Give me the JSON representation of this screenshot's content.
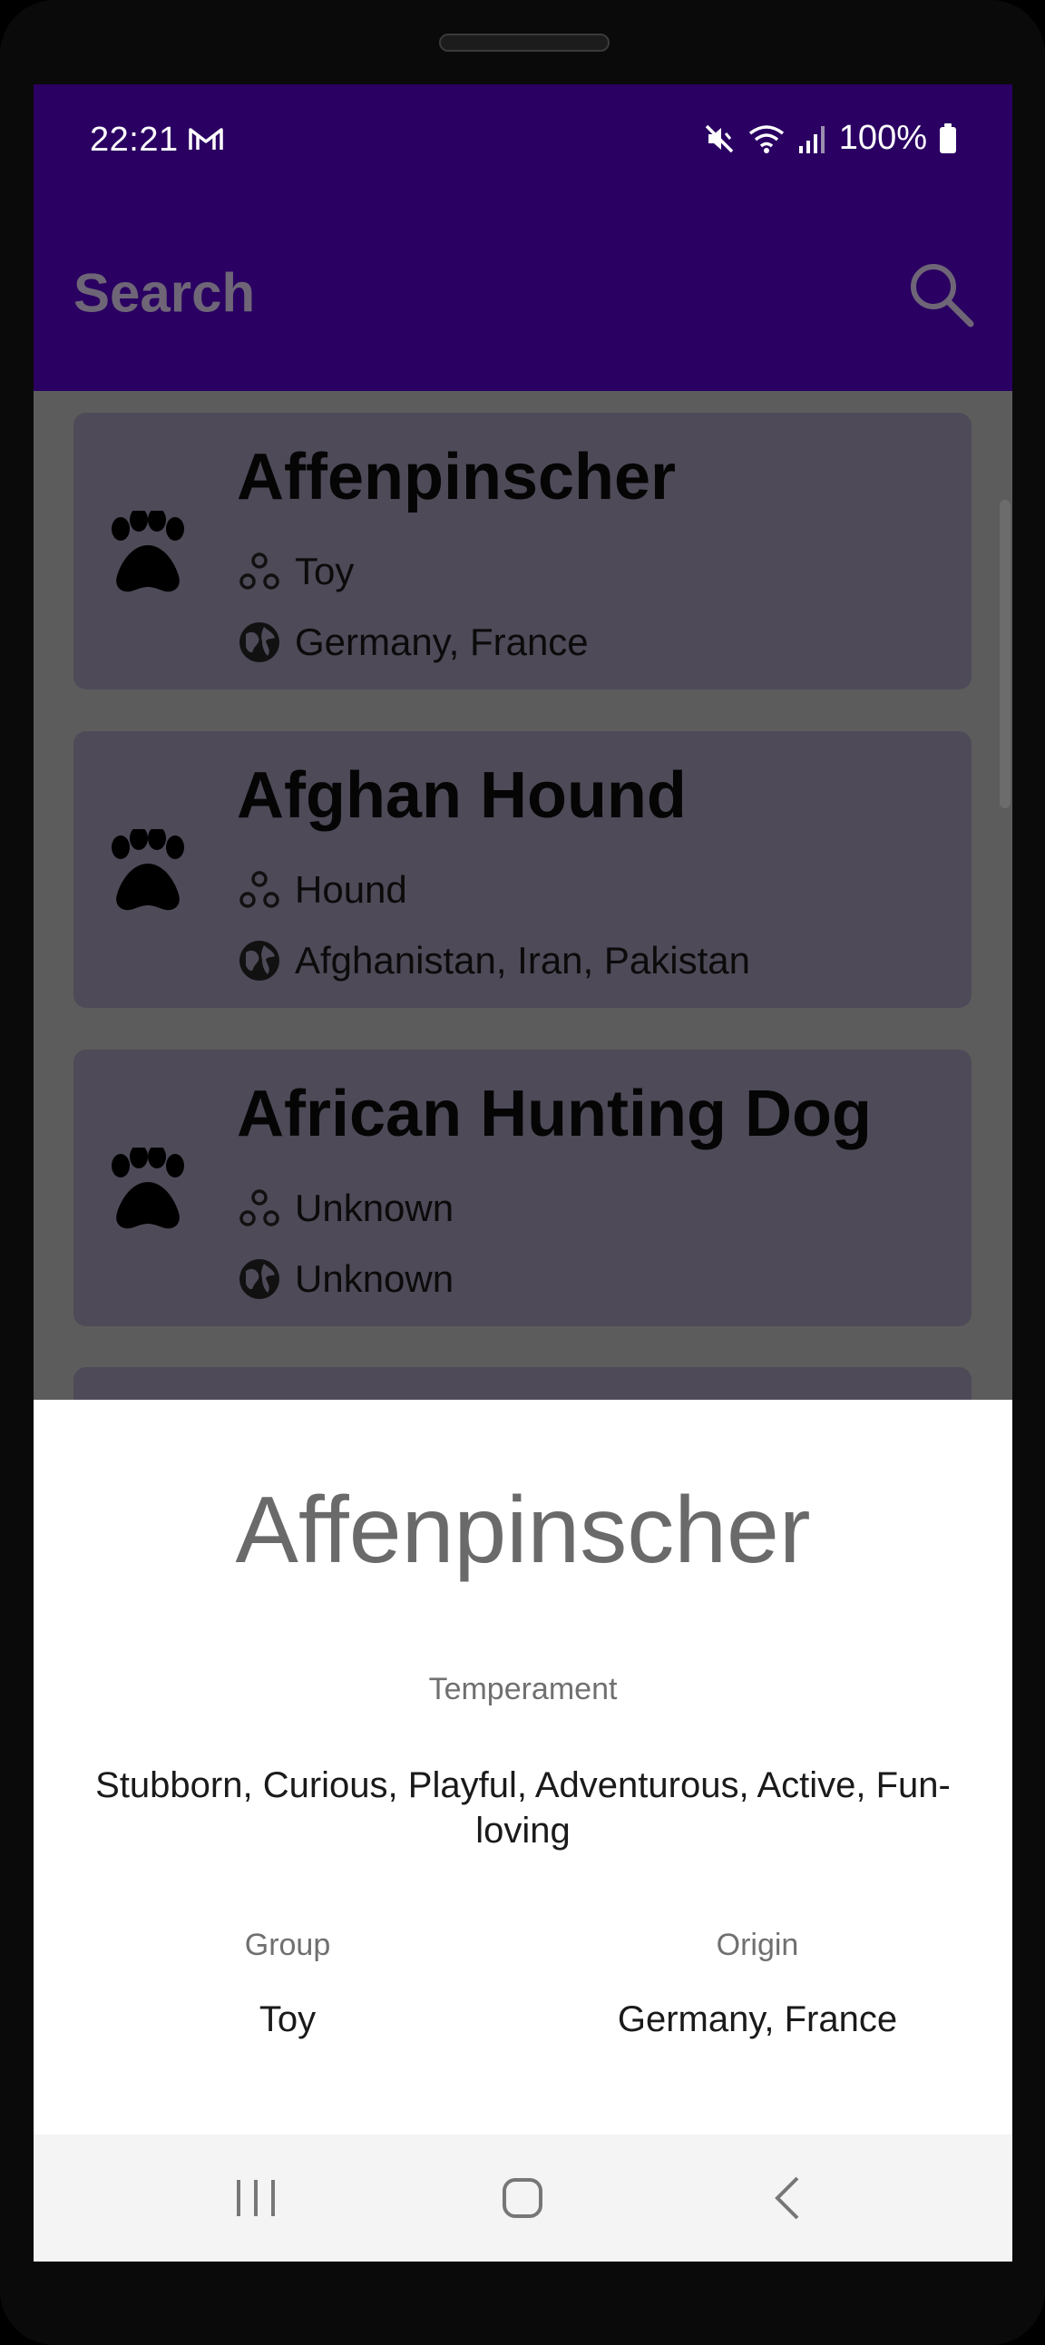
{
  "status_bar": {
    "time": "22:21",
    "battery": "100%"
  },
  "top_bar": {
    "search_label": "Search"
  },
  "list": [
    {
      "title": "Affenpinscher",
      "group": "Toy",
      "origin": "Germany, France"
    },
    {
      "title": "Afghan Hound",
      "group": "Hound",
      "origin": "Afghanistan, Iran, Pakistan"
    },
    {
      "title": "African Hunting Dog",
      "group": "Unknown",
      "origin": "Unknown"
    }
  ],
  "detail_sheet": {
    "title": "Affenpinscher",
    "temperament_label": "Temperament",
    "temperament_value": "Stubborn, Curious, Playful, Adventurous, Active, Fun-loving",
    "group_label": "Group",
    "group_value": "Toy",
    "origin_label": "Origin",
    "origin_value": "Germany, France"
  },
  "colors": {
    "app_bar": "#2a0062",
    "card": "#4e4a58",
    "scrim": "#5c5c5c"
  },
  "icons": [
    "gmail-icon",
    "mute-icon",
    "wifi-icon",
    "signal-icon",
    "battery-icon",
    "search-icon",
    "paw-icon",
    "group-icon",
    "globe-icon",
    "recents-icon",
    "home-icon",
    "back-icon"
  ]
}
